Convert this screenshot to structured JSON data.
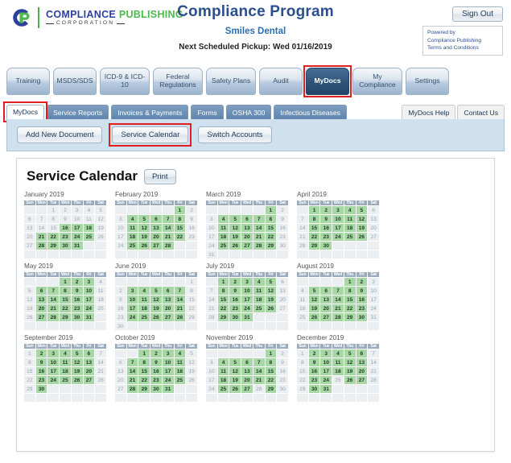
{
  "brand": {
    "name_part1": "COMPLIANCE",
    "name_part2": "PUBLISHING",
    "subtitle": "CORPORATION",
    "blue": "#2f3f9e",
    "green": "#4fb84f"
  },
  "header": {
    "program_title": "Compliance Program",
    "account_name": "Smiles Dental",
    "next_pickup": "Next Scheduled Pickup: Wed 01/16/2019",
    "sign_out": "Sign Out",
    "powered_by": {
      "line1": "Powered by",
      "line2": "Compliance Publishing",
      "line3": "Terms and Conditions"
    }
  },
  "primary_tabs": [
    {
      "label": "Training",
      "active": false
    },
    {
      "label": "MSDS/SDS",
      "active": false
    },
    {
      "label": "ICD-9 & ICD-10",
      "active": false
    },
    {
      "label": "Federal Regulations",
      "active": false
    },
    {
      "label": "Safety Plans",
      "active": false
    },
    {
      "label": "Audit",
      "active": false
    },
    {
      "label": "MyDocs",
      "active": true
    },
    {
      "label": "My Compliance",
      "active": false
    },
    {
      "label": "Settings",
      "active": false
    }
  ],
  "secondary_tabs": [
    {
      "label": "MyDocs",
      "active": true
    },
    {
      "label": "Service Reports",
      "active": false
    },
    {
      "label": "Invoices & Payments",
      "active": false
    },
    {
      "label": "Forms",
      "active": false
    },
    {
      "label": "OSHA 300",
      "active": false
    },
    {
      "label": "Infectious Diseases",
      "active": false
    }
  ],
  "right_tabs": [
    {
      "label": "MyDocs Help"
    },
    {
      "label": "Contact Us"
    }
  ],
  "action_buttons": [
    {
      "label": "Add New Document",
      "highlighted": false
    },
    {
      "label": "Service Calendar",
      "highlighted": true
    },
    {
      "label": "Switch Accounts",
      "highlighted": false
    }
  ],
  "panel": {
    "title": "Service Calendar",
    "print_label": "Print"
  },
  "calendar": {
    "weekday_headers": [
      "Sun",
      "Mon",
      "Tue",
      "Wed",
      "Thu",
      "Fri",
      "Sat"
    ],
    "service_day_color": "#a6d7a5",
    "non_service_day_color": "#eceff1",
    "months": [
      {
        "name": "January 2019",
        "days": 31,
        "first_weekday": 2,
        "service_days": [
          16,
          17,
          18,
          21,
          22,
          23,
          24,
          25,
          28,
          29,
          30,
          31
        ]
      },
      {
        "name": "February 2019",
        "days": 28,
        "first_weekday": 5,
        "service_days": [
          1,
          4,
          5,
          6,
          7,
          8,
          11,
          12,
          13,
          14,
          15,
          18,
          19,
          20,
          21,
          22,
          25,
          26,
          27,
          28
        ]
      },
      {
        "name": "March 2019",
        "days": 31,
        "first_weekday": 5,
        "service_days": [
          1,
          4,
          5,
          6,
          7,
          8,
          11,
          12,
          13,
          14,
          15,
          18,
          19,
          20,
          21,
          22,
          25,
          26,
          27,
          28,
          29
        ]
      },
      {
        "name": "April 2019",
        "days": 30,
        "first_weekday": 1,
        "service_days": [
          1,
          2,
          3,
          4,
          5,
          8,
          9,
          10,
          11,
          12,
          15,
          16,
          17,
          18,
          19,
          22,
          23,
          24,
          25,
          26,
          29,
          30
        ]
      },
      {
        "name": "May 2019",
        "days": 31,
        "first_weekday": 3,
        "service_days": [
          1,
          2,
          3,
          6,
          7,
          8,
          9,
          10,
          13,
          14,
          15,
          16,
          17,
          20,
          21,
          22,
          23,
          24,
          27,
          28,
          29,
          30,
          31
        ]
      },
      {
        "name": "June 2019",
        "days": 30,
        "first_weekday": 6,
        "service_days": [
          3,
          4,
          5,
          6,
          7,
          10,
          11,
          12,
          13,
          14,
          17,
          18,
          19,
          20,
          21,
          24,
          25,
          26,
          27,
          28
        ]
      },
      {
        "name": "July 2019",
        "days": 31,
        "first_weekday": 1,
        "service_days": [
          1,
          2,
          3,
          4,
          5,
          8,
          9,
          10,
          11,
          12,
          15,
          16,
          17,
          18,
          19,
          22,
          23,
          24,
          25,
          26,
          29,
          30,
          31
        ]
      },
      {
        "name": "August 2019",
        "days": 31,
        "first_weekday": 4,
        "service_days": [
          1,
          2,
          5,
          6,
          7,
          8,
          9,
          12,
          13,
          14,
          15,
          16,
          19,
          20,
          21,
          22,
          23,
          26,
          27,
          28,
          29,
          30
        ]
      },
      {
        "name": "September 2019",
        "days": 30,
        "first_weekday": 0,
        "service_days": [
          2,
          3,
          4,
          5,
          6,
          9,
          10,
          11,
          12,
          13,
          16,
          17,
          18,
          19,
          20,
          23,
          24,
          25,
          26,
          27,
          30
        ]
      },
      {
        "name": "October 2019",
        "days": 31,
        "first_weekday": 2,
        "service_days": [
          1,
          2,
          3,
          4,
          7,
          8,
          9,
          10,
          11,
          14,
          15,
          16,
          17,
          18,
          21,
          22,
          23,
          24,
          25,
          28,
          29,
          30,
          31
        ]
      },
      {
        "name": "November 2019",
        "days": 30,
        "first_weekday": 5,
        "service_days": [
          1,
          4,
          5,
          6,
          7,
          8,
          11,
          12,
          13,
          14,
          15,
          18,
          19,
          20,
          21,
          22,
          25,
          26,
          27,
          29
        ]
      },
      {
        "name": "December 2019",
        "days": 31,
        "first_weekday": 0,
        "service_days": [
          2,
          3,
          4,
          5,
          6,
          9,
          10,
          11,
          12,
          13,
          16,
          17,
          18,
          19,
          20,
          23,
          24,
          26,
          27,
          30,
          31
        ]
      }
    ]
  }
}
